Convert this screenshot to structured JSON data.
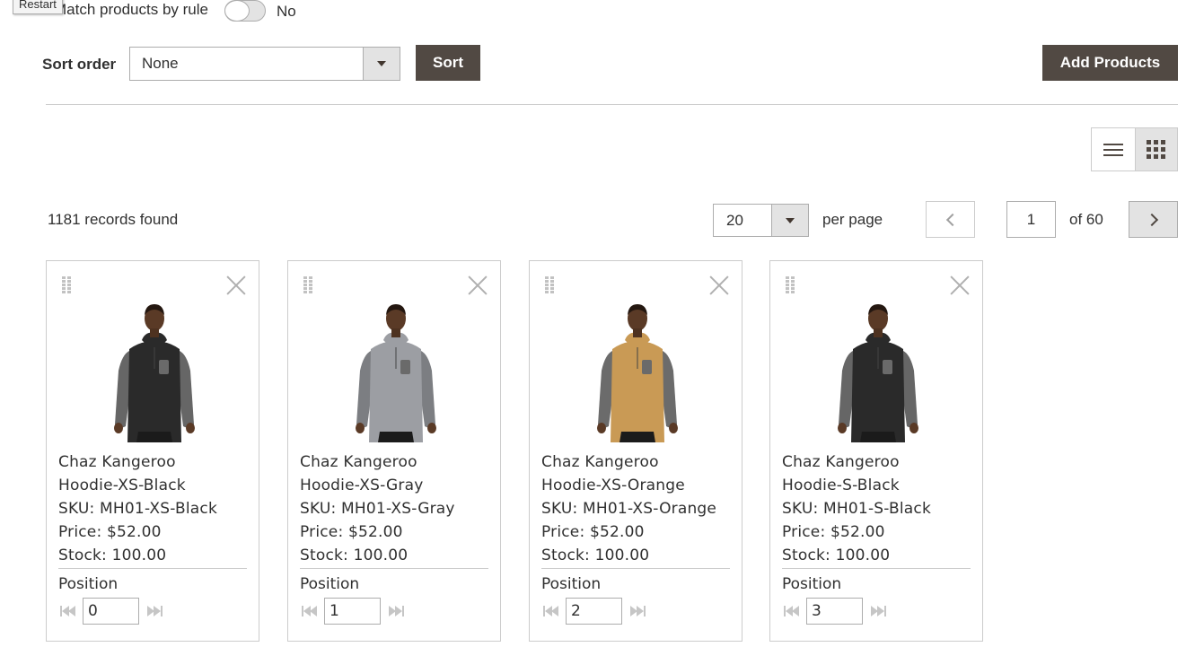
{
  "tooltip": "Restart",
  "rule": {
    "label": "Match products by rule",
    "value": "No"
  },
  "sort": {
    "label": "Sort order",
    "selected": "None",
    "button": "Sort"
  },
  "add_button": "Add Products",
  "grid": {
    "records": "1181 records found",
    "per_page_value": "20",
    "per_page_label": "per page",
    "current_page": "1",
    "of_pages": "of 60"
  },
  "products": [
    {
      "name_line1": "Chaz Kangeroo",
      "name_line2": "Hoodie-XS-Black",
      "sku": "SKU: MH01-XS-Black",
      "price": "Price: $52.00",
      "stock": "Stock: 100.00",
      "position_label": "Position",
      "position": "0",
      "body_color": "#2a2a2a",
      "sleeve_color": "#666666"
    },
    {
      "name_line1": "Chaz Kangeroo",
      "name_line2": "Hoodie-XS-Gray",
      "sku": "SKU: MH01-XS-Gray",
      "price": "Price: $52.00",
      "stock": "Stock: 100.00",
      "position_label": "Position",
      "position": "1",
      "body_color": "#9c9ea3",
      "sleeve_color": "#7c7e82"
    },
    {
      "name_line1": "Chaz Kangeroo",
      "name_line2": "Hoodie-XS-Orange",
      "sku": "SKU: MH01-XS-Orange",
      "price": "Price: $52.00",
      "stock": "Stock: 100.00",
      "position_label": "Position",
      "position": "2",
      "body_color": "#c99a55",
      "sleeve_color": "#6b6b6b"
    },
    {
      "name_line1": "Chaz Kangeroo",
      "name_line2": "Hoodie-S-Black",
      "sku": "SKU: MH01-S-Black",
      "price": "Price: $52.00",
      "stock": "Stock: 100.00",
      "position_label": "Position",
      "position": "3",
      "body_color": "#2a2a2a",
      "sleeve_color": "#666666"
    }
  ],
  "icons": {
    "list_view": "list-view-icon",
    "grid_view": "grid-view-icon",
    "drag": "drag-handle-icon",
    "remove": "close-icon",
    "first": "skip-first-icon",
    "last": "skip-last-icon"
  },
  "colors": {
    "button_dark": "#514943",
    "border": "#adadad",
    "toolbar_gray": "#e3e3e3"
  }
}
